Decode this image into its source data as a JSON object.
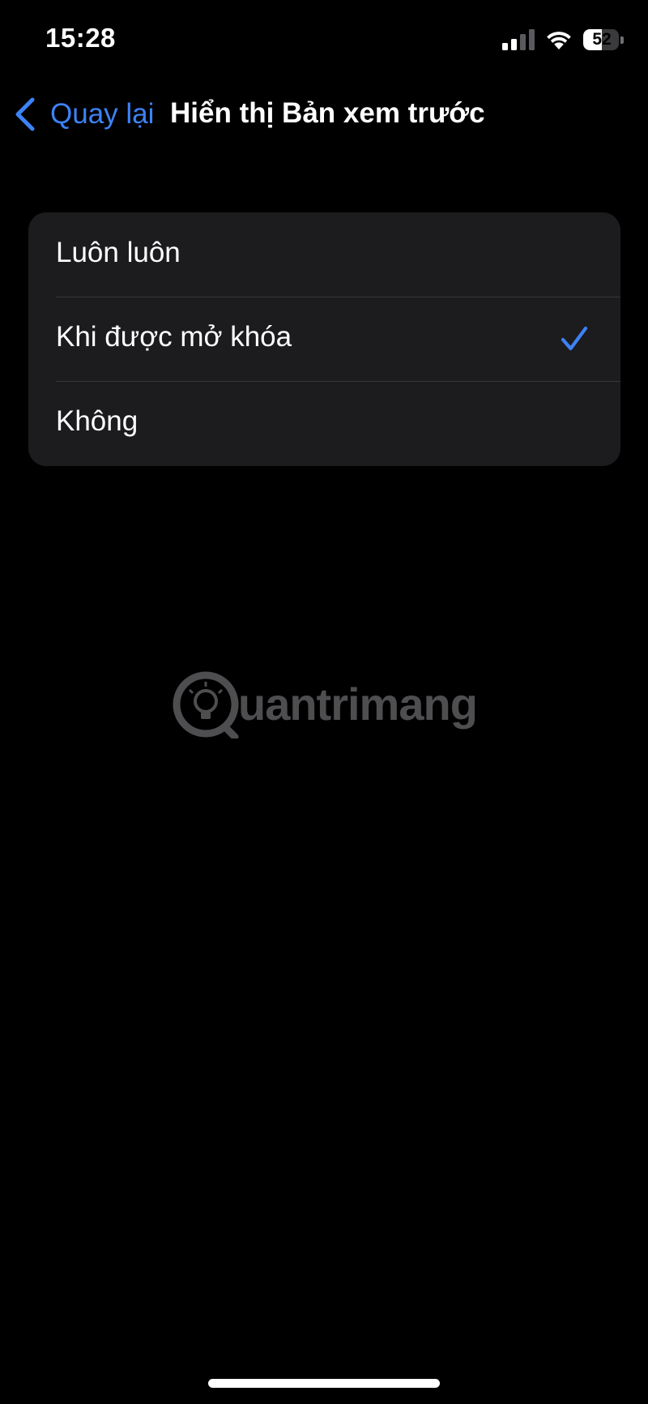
{
  "status_bar": {
    "time": "15:28",
    "battery_level": "52",
    "battery_fraction": 0.52,
    "signal_icon": "cellular-signal-icon",
    "wifi_icon": "wifi-icon"
  },
  "nav": {
    "back_label": "Quay lại",
    "back_icon": "chevron-left-icon",
    "title": "Hiển thị Bản xem trước"
  },
  "options": [
    {
      "label": "Luôn luôn",
      "selected": false
    },
    {
      "label": "Khi được mở khóa",
      "selected": true
    },
    {
      "label": "Không",
      "selected": false
    }
  ],
  "watermark": {
    "text": "uantrimang",
    "icon": "lightbulb-logo-icon"
  },
  "colors": {
    "accent": "#3d82f6",
    "background": "#000000",
    "group_background": "#1c1c1e",
    "separator": "#38383a"
  }
}
